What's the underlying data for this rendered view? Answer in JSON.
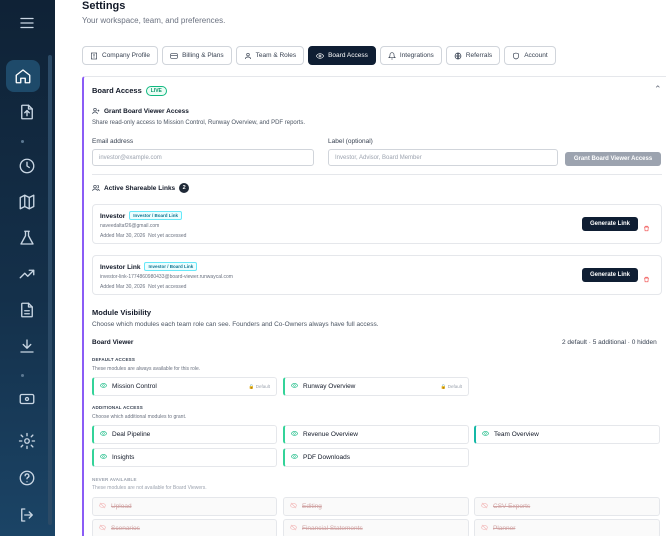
{
  "sidebar": {
    "items": [
      {
        "icon": "menu-icon"
      },
      {
        "icon": "home-icon",
        "active": true
      },
      {
        "icon": "upload-file-icon"
      },
      {
        "icon": "clock-icon"
      },
      {
        "icon": "map-icon"
      },
      {
        "icon": "flask-icon"
      },
      {
        "icon": "trending-up-icon"
      },
      {
        "icon": "document-icon"
      },
      {
        "icon": "download-icon"
      },
      {
        "icon": "presentation-icon"
      },
      {
        "icon": "gear-icon"
      },
      {
        "icon": "help-icon"
      },
      {
        "icon": "logout-icon"
      }
    ]
  },
  "header": {
    "title": "Settings",
    "subtitle": "Your workspace, team, and preferences."
  },
  "tabs": [
    {
      "label": "Company Profile",
      "icon": "building-icon"
    },
    {
      "label": "Billing & Plans",
      "icon": "credit-card-icon"
    },
    {
      "label": "Team & Roles",
      "icon": "user-icon"
    },
    {
      "label": "Board Access",
      "icon": "eye-icon",
      "active": true
    },
    {
      "label": "Integrations",
      "icon": "bell-icon"
    },
    {
      "label": "Referrals",
      "icon": "globe-icon"
    },
    {
      "label": "Account",
      "icon": "shield-icon"
    }
  ],
  "board": {
    "title": "Board Access",
    "badge": "LIVE",
    "grant": {
      "title": "Grant Board Viewer Access",
      "desc": "Share read-only access to Mission Control, Runway Overview, and PDF reports.",
      "email_label": "Email address",
      "email_placeholder": "investor@example.com",
      "label_label": "Label (optional)",
      "label_placeholder": "Investor, Advisor, Board Member",
      "button": "Grant Board Viewer Access"
    },
    "links": {
      "title": "Active Shareable Links",
      "count": "2",
      "items": [
        {
          "name": "Investor",
          "badge": "Investor / Board Link",
          "email": "naveedaltaf26@gmail.com",
          "added": "Added Mar 30, 2026",
          "status": "Not yet accessed",
          "button": "Generate Link"
        },
        {
          "name": "Investor Link",
          "badge": "Investor / Board Link",
          "email": "investor-link-1774860980433@board-viewer.runwaycal.com",
          "added": "Added Mar 30, 2026",
          "status": "Not yet accessed",
          "button": "Generate Link"
        }
      ]
    },
    "modules": {
      "title": "Module Visibility",
      "desc": "Choose which modules each team role can see. Founders and Co-Owners always have full access.",
      "role": "Board Viewer",
      "summary": "2 default · 5 additional · 0 hidden",
      "default_head": "DEFAULT ACCESS",
      "default_desc": "These modules are always available for this role.",
      "default_items": [
        {
          "label": "Mission Control",
          "tag": "Default"
        },
        {
          "label": "Runway Overview",
          "tag": "Default"
        }
      ],
      "additional_head": "ADDITIONAL ACCESS",
      "additional_desc": "Choose which additional modules to grant.",
      "additional_items": [
        {
          "label": "Deal Pipeline"
        },
        {
          "label": "Revenue Overview"
        },
        {
          "label": "Team Overview"
        },
        {
          "label": "Insights"
        },
        {
          "label": "PDF Downloads"
        }
      ],
      "never_head": "NEVER AVAILABLE",
      "never_desc": "These modules are not available for Board Viewers.",
      "never_items": [
        {
          "label": "Upload"
        },
        {
          "label": "Editing"
        },
        {
          "label": "CSV Exports"
        },
        {
          "label": "Scenarios"
        },
        {
          "label": "Financial Statements"
        },
        {
          "label": "Planner"
        }
      ]
    }
  },
  "colors": {
    "sidebar": "#0f2236",
    "accent_dark": "#0f1e33",
    "live": "#10b981",
    "card_border_accent": "#8b5cf6",
    "danger": "#ef4444"
  }
}
